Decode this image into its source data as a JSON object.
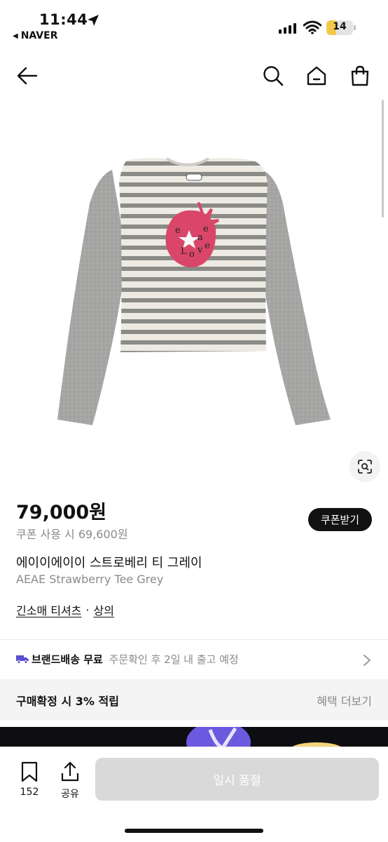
{
  "status": {
    "time": "11:44",
    "back_app": "NAVER",
    "battery": "14"
  },
  "nav": {
    "icons": [
      "back-arrow-icon",
      "search-icon",
      "home-icon",
      "shopping-bag-icon"
    ]
  },
  "product": {
    "price": "79,000원",
    "coupon_price": "쿠폰 사용 시 69,600원",
    "coupon_button": "쿠폰받기",
    "name_ko": "에이이에이이 스트로베리 티 그레이",
    "name_en": "AEAE Strawberry Tee Grey",
    "category_1": "긴소매 티셔츠",
    "category_sep": "·",
    "category_2": "상의"
  },
  "shipping": {
    "label": "브랜드배송 무료",
    "detail": "주문확인 후 2일 내 출고 예정"
  },
  "benefit": {
    "title": "구매확정 시 3% 적립",
    "more": "혜택 더보기"
  },
  "bottom": {
    "bookmark_count": "152",
    "share_label": "공유",
    "cta": "일시 품절"
  },
  "colors": {
    "accent_truck": "#5a4fcf",
    "soldout_bg": "#d9d9d9"
  }
}
